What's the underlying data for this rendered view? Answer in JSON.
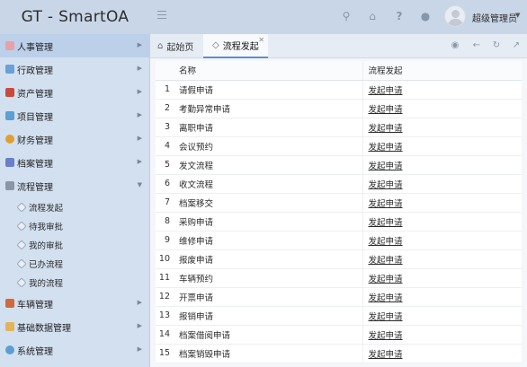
{
  "header": {
    "app_title": "GT - SmartOA",
    "username": "超级管理员"
  },
  "sidebar": {
    "items": [
      {
        "label": "人事管理",
        "icon": "user-icon",
        "color": "#e9a0a8"
      },
      {
        "label": "行政管理",
        "icon": "building-icon",
        "color": "#6aa0d8"
      },
      {
        "label": "资产管理",
        "icon": "assets-icon",
        "color": "#c84a3c"
      },
      {
        "label": "项目管理",
        "icon": "folder-icon",
        "color": "#5b9fd6"
      },
      {
        "label": "财务管理",
        "icon": "coin-icon",
        "color": "#e0a030"
      },
      {
        "label": "档案管理",
        "icon": "archive-icon",
        "color": "#6a7fc8"
      },
      {
        "label": "流程管理",
        "icon": "flow-icon",
        "color": "#8a96a6"
      },
      {
        "label": "车辆管理",
        "icon": "car-icon",
        "color": "#d06a3a"
      },
      {
        "label": "基础数据管理",
        "icon": "data-icon",
        "color": "#e3b35a"
      },
      {
        "label": "系统管理",
        "icon": "system-icon",
        "color": "#5aa0d0"
      }
    ],
    "sub_items": [
      "流程发起",
      "待我审批",
      "我的审批",
      "已办流程",
      "我的流程"
    ]
  },
  "tabs": {
    "home_label": "起始页",
    "active_label": "流程发起"
  },
  "table": {
    "headers": [
      "名称",
      "流程发起"
    ],
    "rows": [
      {
        "num": "1",
        "name": "请假申请",
        "action": "发起申请"
      },
      {
        "num": "2",
        "name": "考勤异常申请",
        "action": "发起申请"
      },
      {
        "num": "3",
        "name": "离职申请",
        "action": "发起申请"
      },
      {
        "num": "4",
        "name": "会议预约",
        "action": "发起申请"
      },
      {
        "num": "5",
        "name": "发文流程",
        "action": "发起申请"
      },
      {
        "num": "6",
        "name": "收文流程",
        "action": "发起申请"
      },
      {
        "num": "7",
        "name": "档案移交",
        "action": "发起申请"
      },
      {
        "num": "8",
        "name": "采购申请",
        "action": "发起申请"
      },
      {
        "num": "9",
        "name": "维修申请",
        "action": "发起申请"
      },
      {
        "num": "10",
        "name": "报废申请",
        "action": "发起申请"
      },
      {
        "num": "11",
        "name": "车辆预约",
        "action": "发起申请"
      },
      {
        "num": "12",
        "name": "开票申请",
        "action": "发起申请"
      },
      {
        "num": "13",
        "name": "报销申请",
        "action": "发起申请"
      },
      {
        "num": "14",
        "name": "档案借阅申请",
        "action": "发起申请"
      },
      {
        "num": "15",
        "name": "档案销毁申请",
        "action": "发起申请"
      }
    ]
  }
}
